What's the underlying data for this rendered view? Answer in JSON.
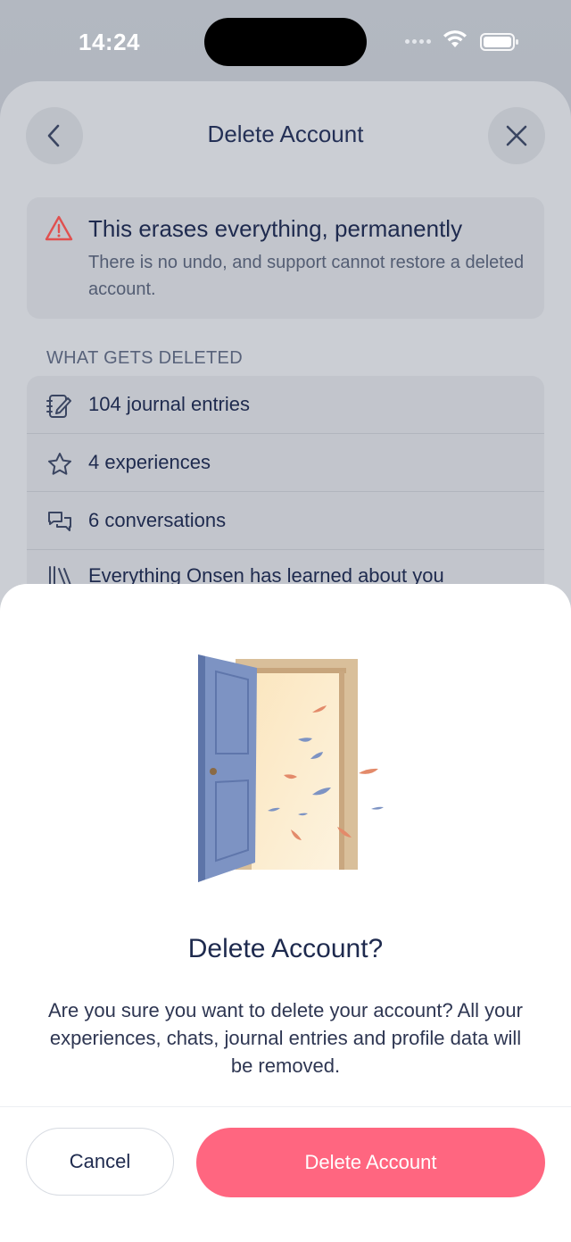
{
  "status_bar": {
    "time": "14:24"
  },
  "background_page": {
    "title": "Delete Account",
    "warning": {
      "title": "This erases everything, permanently",
      "subtitle": "There is no undo, and support cannot restore a deleted account."
    },
    "section_label": "WHAT GETS DELETED",
    "items": [
      {
        "icon": "journal-icon",
        "label": "104 journal entries"
      },
      {
        "icon": "star-icon",
        "label": "4 experiences"
      },
      {
        "icon": "chat-bubbles-icon",
        "label": "6 conversations"
      },
      {
        "icon": "library-icon",
        "label": "Everything Onsen has learned about you"
      }
    ]
  },
  "modal": {
    "title": "Delete Account?",
    "body": "Are you sure you want to delete your account? All your experiences, chats, journal entries and profile data will be removed.",
    "cancel_label": "Cancel",
    "delete_label": "Delete Account"
  },
  "colors": {
    "accent_delete": "#ff6680",
    "text_primary": "#1e2a4e",
    "warning_red": "#e0504f"
  }
}
